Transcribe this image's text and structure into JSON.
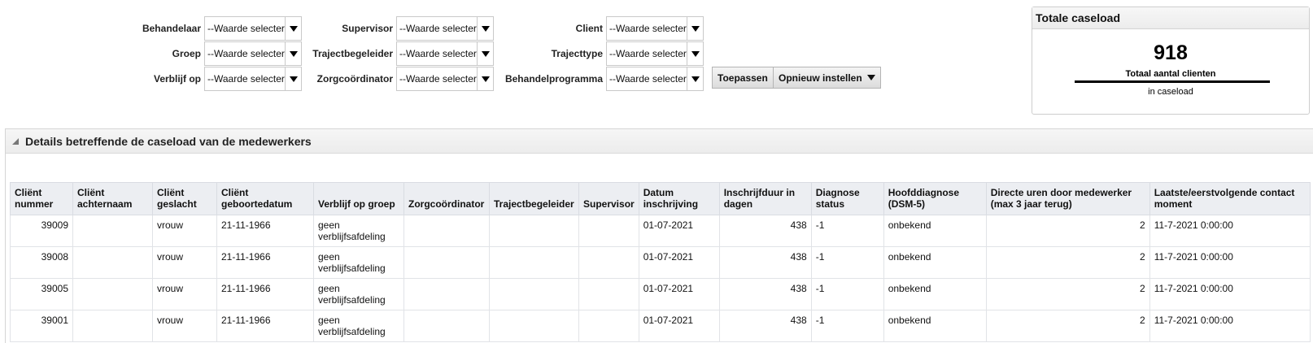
{
  "filters": [
    [
      {
        "label": "Behandelaar",
        "value": "--Waarde selecteren--"
      },
      {
        "label": "Supervisor",
        "value": "--Waarde selecteren--"
      },
      {
        "label": "Client",
        "value": "--Waarde selecteren--"
      }
    ],
    [
      {
        "label": "Groep",
        "value": "--Waarde selecteren--"
      },
      {
        "label": "Trajectbegeleider",
        "value": "--Waarde selecteren--"
      },
      {
        "label": "Trajecttype",
        "value": "--Waarde selecteren--"
      }
    ],
    [
      {
        "label": "Verblijf op",
        "value": "--Waarde selecteren--"
      },
      {
        "label": "Zorgcoördinator",
        "value": "--Waarde selecteren--"
      },
      {
        "label": "Behandelprogramma",
        "value": "--Waarde selecteren--"
      }
    ]
  ],
  "buttons": {
    "apply": "Toepassen",
    "reset": "Opnieuw instellen"
  },
  "caseload": {
    "title": "Totale caseload",
    "total": "918",
    "label1": "Totaal aantal clienten",
    "label2": "in caseload"
  },
  "section": {
    "title": "Details betreffende de caseload van de medewerkers"
  },
  "table": {
    "columns": [
      "Cliënt nummer",
      "Cliënt achternaam",
      "Cliënt geslacht",
      "Cliënt geboortedatum",
      "Verblijf op groep",
      "Zorgcoördinator",
      "Trajectbegeleider",
      "Supervisor",
      "Datum inschrijving",
      "Inschrijfduur in dagen",
      "Diagnose status",
      "Hoofddiagnose (DSM-5)",
      "Directe uren door medewerker (max 3 jaar terug)",
      "Laatste/eerstvolgende contact moment"
    ],
    "rows": [
      [
        "39009",
        "",
        "vrouw",
        "21-11-1966",
        "geen verblijfsafdeling",
        "",
        "",
        "",
        "01-07-2021",
        "438",
        "-1",
        "onbekend",
        "2",
        "11-7-2021 0:00:00"
      ],
      [
        "39008",
        "",
        "vrouw",
        "21-11-1966",
        "geen verblijfsafdeling",
        "",
        "",
        "",
        "01-07-2021",
        "438",
        "-1",
        "onbekend",
        "2",
        "11-7-2021 0:00:00"
      ],
      [
        "39005",
        "",
        "vrouw",
        "21-11-1966",
        "geen verblijfsafdeling",
        "",
        "",
        "",
        "01-07-2021",
        "438",
        "-1",
        "onbekend",
        "2",
        "11-7-2021 0:00:00"
      ],
      [
        "39001",
        "",
        "vrouw",
        "21-11-1966",
        "geen verblijfsafdeling",
        "",
        "",
        "",
        "01-07-2021",
        "438",
        "-1",
        "onbekend",
        "2",
        "11-7-2021 0:00:00"
      ]
    ]
  }
}
